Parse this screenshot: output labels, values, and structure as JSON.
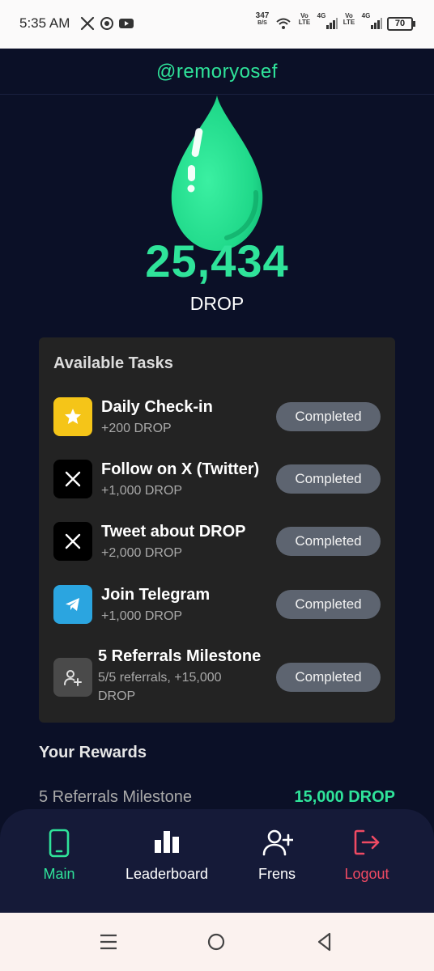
{
  "status_bar": {
    "time": "5:35 AM",
    "net_speed_value": "347",
    "net_speed_unit": "B/S",
    "volte_1": "Vo\nLTE",
    "net_1": "4G",
    "volte_2": "Vo\nLTE",
    "net_2": "4G",
    "battery": "70"
  },
  "profile": {
    "username": "@remoryosef"
  },
  "balance": {
    "value": "25,434",
    "unit": "DROP"
  },
  "tasks": {
    "title": "Available Tasks",
    "items": [
      {
        "title": "Daily Check-in",
        "sub": "+200 DROP",
        "status": "Completed",
        "icon": "star-icon"
      },
      {
        "title": "Follow on X (Twitter)",
        "sub": "+1,000 DROP",
        "status": "Completed",
        "icon": "x-logo-icon"
      },
      {
        "title": "Tweet about DROP",
        "sub": "+2,000 DROP",
        "status": "Completed",
        "icon": "x-logo-icon"
      },
      {
        "title": "Join Telegram",
        "sub": "+1,000 DROP",
        "status": "Completed",
        "icon": "telegram-icon"
      },
      {
        "title": "5 Referrals Milestone",
        "sub": "5/5 referrals, +15,000 DROP",
        "status": "Completed",
        "icon": "user-plus-icon"
      }
    ]
  },
  "rewards": {
    "title": "Your Rewards",
    "items": [
      {
        "name": "5 Referrals Milestone",
        "amount": "15,000 DROP"
      }
    ]
  },
  "nav": {
    "items": [
      {
        "label": "Main",
        "icon": "phone-icon",
        "active": true
      },
      {
        "label": "Leaderboard",
        "icon": "bar-chart-icon"
      },
      {
        "label": "Frens",
        "icon": "user-plus-icon"
      },
      {
        "label": "Logout",
        "icon": "logout-icon"
      }
    ]
  },
  "colors": {
    "background": "#0b1027",
    "accent": "#2fe39a",
    "card": "#232323",
    "button": "#5d6470",
    "logout": "#ef4a63",
    "navbar": "#151a38"
  }
}
